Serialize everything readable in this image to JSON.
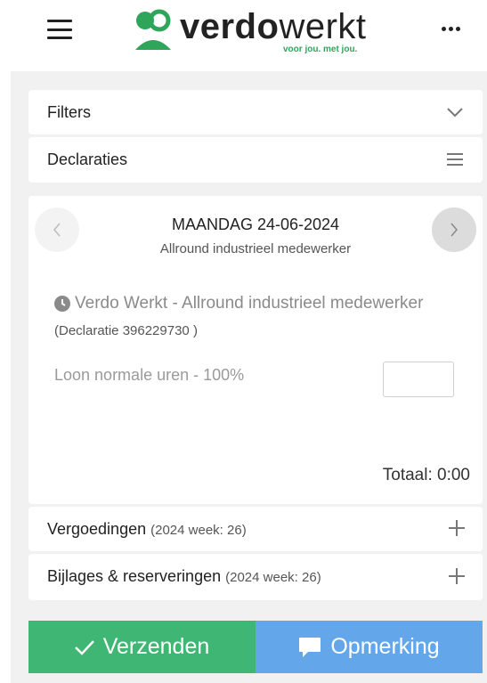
{
  "header": {
    "brand_bold": "verdo",
    "brand_light": "werkt",
    "tagline": "voor jou. met jou.",
    "brand_color": "#2fa55a"
  },
  "sections": {
    "filters_label": "Filters",
    "declaraties_label": "Declaraties"
  },
  "day": {
    "title": "MAANDAG 24-06-2024",
    "subtitle": "Allround industrieel medewerker",
    "company_line": "Verdo Werkt - Allround industrieel medewerker",
    "declaration_ref": "(Declaratie 396229730 )",
    "wage_line": "Loon normale uren - 100%",
    "hours_value": "",
    "total": "Totaal: 0:00"
  },
  "vergoedingen": {
    "label": "Vergoedingen",
    "week": "(2024 week: 26)"
  },
  "bijlages": {
    "label": "Bijlages & reserveringen",
    "week": "(2024 week: 26)"
  },
  "actions": {
    "send_label": "Verzenden",
    "note_label": "Opmerking",
    "send_color": "#3fb673",
    "note_color": "#63a7ea"
  },
  "icons": [
    "menu-icon",
    "more-icon",
    "chevron-down-icon",
    "list-icon",
    "chevron-left-icon",
    "chevron-right-icon",
    "clock-icon",
    "plus-icon",
    "check-icon",
    "comment-icon"
  ]
}
